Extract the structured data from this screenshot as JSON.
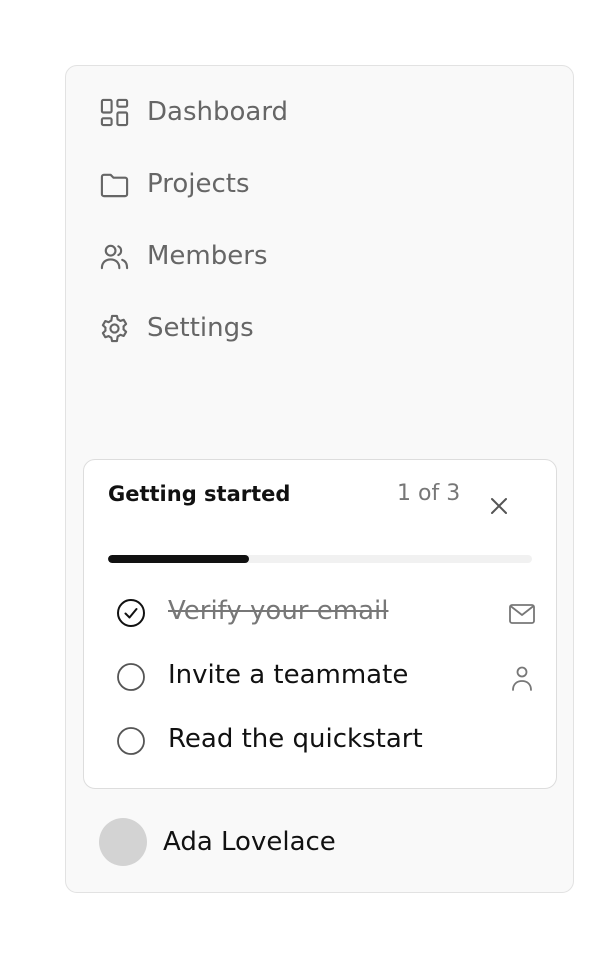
{
  "sidebar": {
    "items": [
      {
        "label": "Dashboard",
        "icon": "dashboard-icon"
      },
      {
        "label": "Projects",
        "icon": "folder-icon"
      },
      {
        "label": "Members",
        "icon": "members-icon"
      },
      {
        "label": "Settings",
        "icon": "gear-icon"
      }
    ]
  },
  "onboarding": {
    "title": "Getting started",
    "count": "1 of 3",
    "progress_fraction": 0.333,
    "close_icon": "close-icon",
    "tasks": [
      {
        "label": "Verify your email",
        "done": true,
        "icon": "mail-icon"
      },
      {
        "label": "Invite a teammate",
        "done": false,
        "icon": "user-icon"
      },
      {
        "label": "Read the quickstart",
        "done": false,
        "icon": ""
      }
    ]
  },
  "user": {
    "name": "Ada Lovelace"
  },
  "colors": {
    "text_primary": "#111111",
    "text_muted": "#666666",
    "progress_fill": "#111111",
    "progress_track": "#f1f1f1",
    "avatar": "#d3d3d3"
  }
}
